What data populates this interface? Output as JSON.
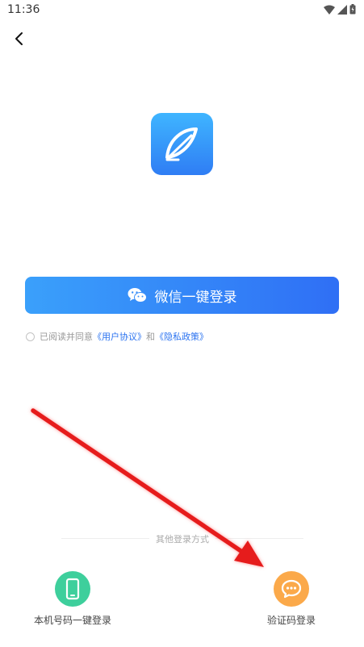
{
  "status_bar": {
    "time": "11:36"
  },
  "wechat_login": {
    "label": "微信一键登录"
  },
  "agreement": {
    "prefix": "已阅读并同意",
    "user_agreement": "《用户协议》",
    "conjunction": "和",
    "privacy_policy": "《隐私政策》"
  },
  "other_methods": {
    "divider_text": "其他登录方式",
    "options": [
      {
        "label": "本机号码一键登录",
        "icon": "phone-icon",
        "color": "#3ecf9c"
      },
      {
        "label": "验证码登录",
        "icon": "chat-bubble-icon",
        "color": "#fba94a"
      }
    ]
  },
  "colors": {
    "primary_blue": "#2f6ff5",
    "link_blue": "#2b73f0",
    "annotation_red": "#e61b1b"
  }
}
